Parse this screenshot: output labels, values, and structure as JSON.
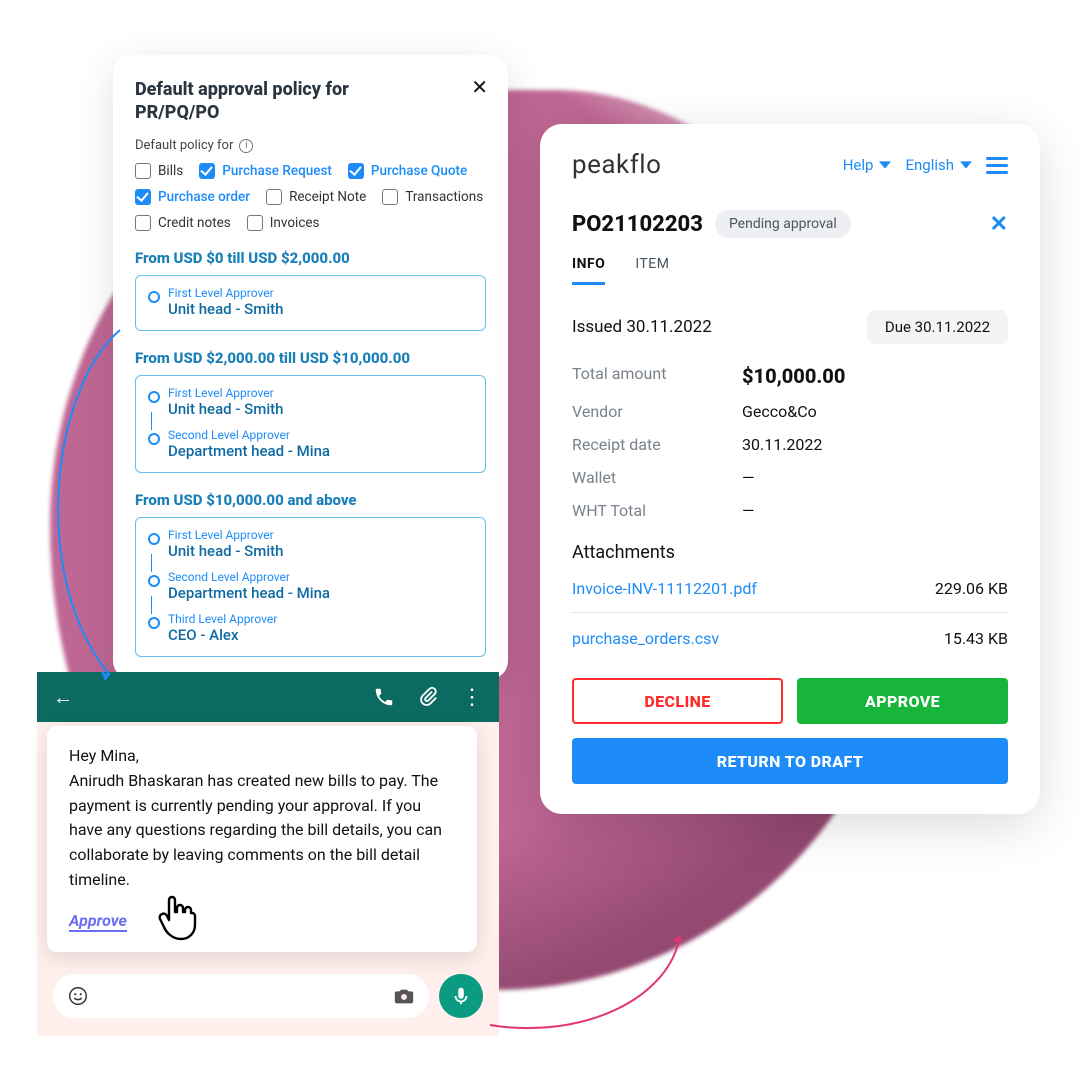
{
  "policy": {
    "title": "Default approval policy for PR/PQ/PO",
    "sub_label": "Default policy for",
    "options": [
      {
        "label": "Bills",
        "checked": false
      },
      {
        "label": "Purchase Request",
        "checked": true
      },
      {
        "label": "Purchase Quote",
        "checked": true
      },
      {
        "label": "Purchase order",
        "checked": true
      },
      {
        "label": "Receipt Note",
        "checked": false
      },
      {
        "label": "Transactions",
        "checked": false
      },
      {
        "label": "Credit notes",
        "checked": false
      },
      {
        "label": "Invoices",
        "checked": false
      }
    ],
    "tiers": [
      {
        "title": "From USD $0 till USD $2,000.00",
        "levels": [
          {
            "label": "First Level Approver",
            "name": "Unit head - Smith"
          }
        ]
      },
      {
        "title": "From USD $2,000.00 till USD $10,000.00",
        "levels": [
          {
            "label": "First Level Approver",
            "name": "Unit head - Smith"
          },
          {
            "label": "Second Level Approver",
            "name": "Department head - Mina"
          }
        ]
      },
      {
        "title": "From USD $10,000.00 and above",
        "levels": [
          {
            "label": "First Level Approver",
            "name": "Unit head - Smith"
          },
          {
            "label": "Second Level Approver",
            "name": "Department head - Mina"
          },
          {
            "label": "Third Level Approver",
            "name": "CEO - Alex"
          }
        ]
      }
    ]
  },
  "po": {
    "brand": "peakflo",
    "help": "Help",
    "language": "English",
    "id": "PO21102203",
    "status": "Pending approval",
    "tabs": {
      "info": "INFO",
      "item": "ITEM"
    },
    "issued_label": "Issued 30.11.2022",
    "due_label": "Due 30.11.2022",
    "fields": {
      "total_label": "Total amount",
      "total_value": "$10,000.00",
      "vendor_label": "Vendor",
      "vendor_value": "Gecco&Co",
      "receipt_label": "Receipt date",
      "receipt_value": "30.11.2022",
      "wallet_label": "Wallet",
      "wallet_value": "—",
      "wht_label": "WHT Total",
      "wht_value": "—"
    },
    "attachments_title": "Attachments",
    "attachments": [
      {
        "name": "Invoice-INV-11112201.pdf",
        "size": "229.06 KB"
      },
      {
        "name": "purchase_orders.csv",
        "size": "15.43 KB"
      }
    ],
    "buttons": {
      "decline": "DECLINE",
      "approve": "APPROVE",
      "draft": "RETURN TO DRAFT"
    }
  },
  "chat": {
    "message": "Hey Mina,\nAnirudh Bhaskaran has created new bills to pay. The payment is currently pending your approval. If you have any questions regarding the bill details, you can collaborate by leaving comments on the bill detail timeline.",
    "approve": "Approve"
  }
}
